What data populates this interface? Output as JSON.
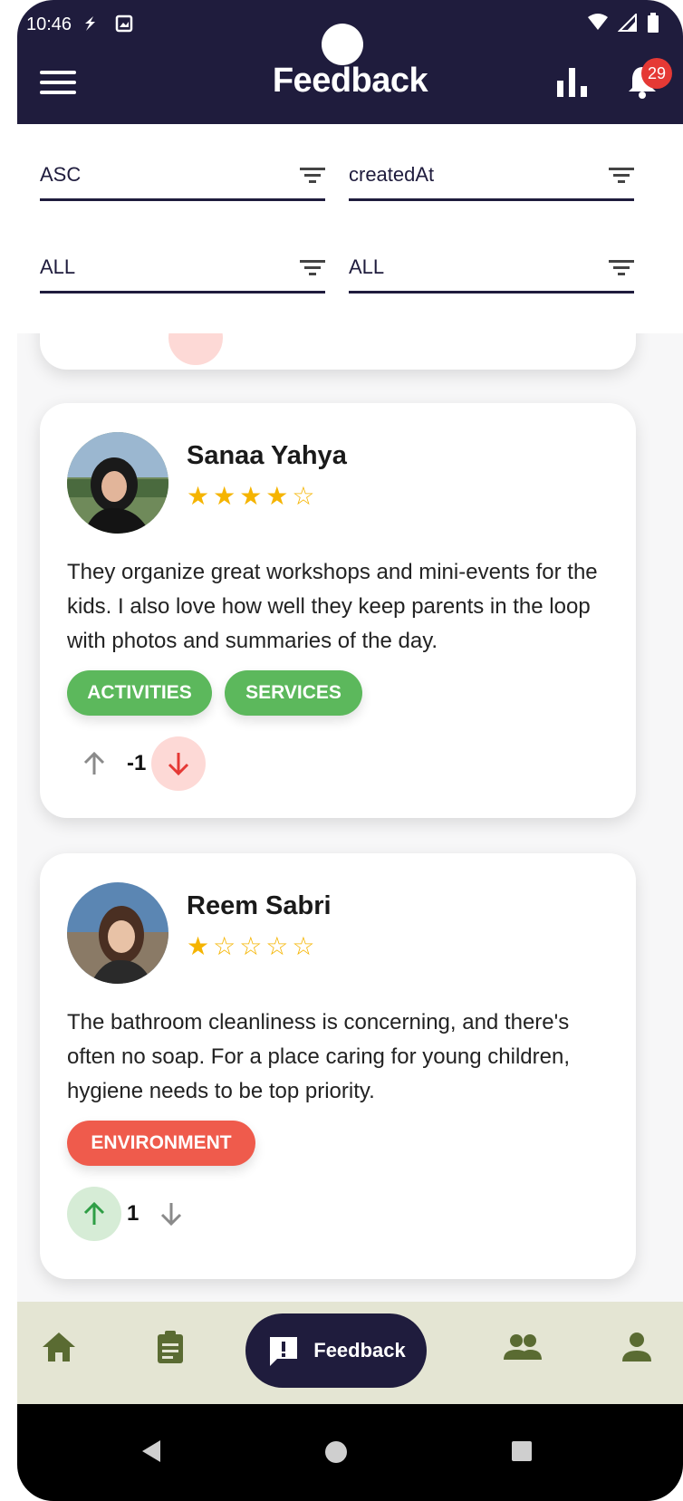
{
  "status_bar": {
    "time": "10:46"
  },
  "app_bar": {
    "title": "Feedback",
    "notification_count": "29"
  },
  "filters": [
    {
      "value": "ASC"
    },
    {
      "value": "createdAt"
    },
    {
      "value": "ALL"
    },
    {
      "value": "ALL"
    }
  ],
  "feedback": [
    {
      "name": "Sanaa Yahya",
      "rating": 4,
      "stars": "★★★★☆",
      "comment": "They organize great workshops and mini-events for the kids. I also love how well they keep parents in the loop with photos and summaries of the day.",
      "tags": [
        "ACTIVITIES",
        "SERVICES"
      ],
      "score": "-1",
      "vote_state": "down"
    },
    {
      "name": "Reem Sabri",
      "rating": 1,
      "stars": "★☆☆☆☆",
      "comment": "The bathroom cleanliness is concerning, and there's often no soap. For a place caring for young children, hygiene needs to be top priority.",
      "tags": [
        "ENVIRONMENT"
      ],
      "score": "1",
      "vote_state": "up"
    }
  ],
  "bottom_nav": {
    "active_label": "Feedback"
  },
  "colors": {
    "primary": "#1f1c3d",
    "star": "#f5b400",
    "tag_green": "#5cb85c",
    "tag_red": "#ef5b4c",
    "nav_bg": "#e4e5d3",
    "nav_icon": "#5a6b32"
  }
}
